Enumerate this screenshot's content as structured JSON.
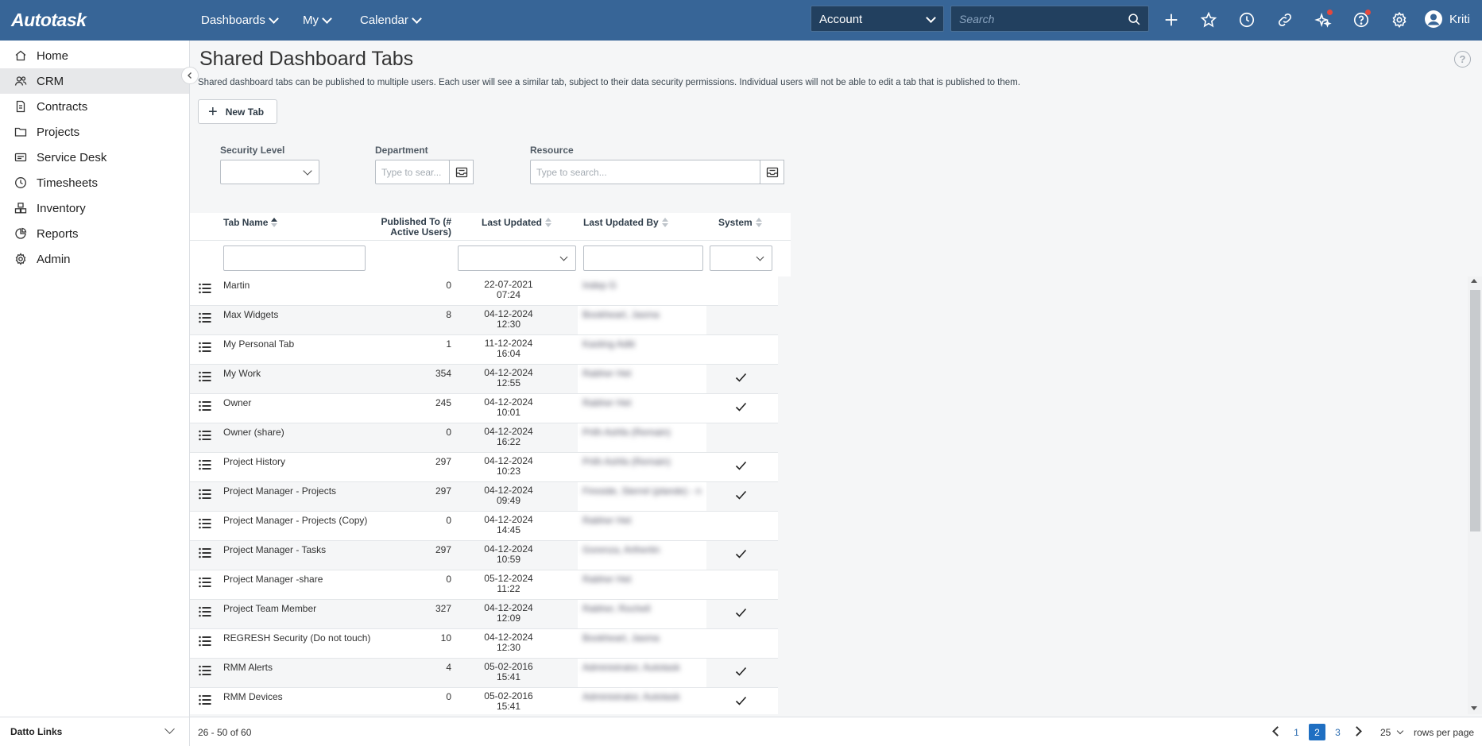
{
  "brand": {
    "logo": "Autotask"
  },
  "topnav": {
    "menus": [
      {
        "label": "Dashboards"
      },
      {
        "label": "My"
      },
      {
        "label": "Calendar"
      }
    ],
    "account_selector": "Account",
    "search_placeholder": "Search",
    "user": "Kriti"
  },
  "sidebar": {
    "items": [
      {
        "label": "Home",
        "icon": "home-icon"
      },
      {
        "label": "CRM",
        "icon": "users-icon"
      },
      {
        "label": "Contracts",
        "icon": "contract-icon"
      },
      {
        "label": "Projects",
        "icon": "folder-icon"
      },
      {
        "label": "Service Desk",
        "icon": "service-desk-icon"
      },
      {
        "label": "Timesheets",
        "icon": "clock-icon"
      },
      {
        "label": "Inventory",
        "icon": "inventory-icon"
      },
      {
        "label": "Reports",
        "icon": "reports-icon"
      },
      {
        "label": "Admin",
        "icon": "gear-icon"
      }
    ],
    "active": "CRM",
    "footer_label": "Datto Links"
  },
  "page": {
    "title": "Shared Dashboard Tabs",
    "description": "Shared dashboard tabs can be published to multiple users. Each user will see a similar tab, subject to their data security permissions. Individual users will not be able to edit a tab that is published to them.",
    "new_tab_label": "New Tab"
  },
  "filters": {
    "security_level_label": "Security Level",
    "department_label": "Department",
    "department_placeholder": "Type to sear...",
    "resource_label": "Resource",
    "resource_placeholder": "Type to search..."
  },
  "table": {
    "columns": {
      "tab_name": "Tab Name",
      "published_to_line1": "Published To (#",
      "published_to_line2": "Active Users)",
      "last_updated": "Last Updated",
      "last_updated_by": "Last Updated By",
      "system": "System"
    },
    "rows": [
      {
        "name": "Martin",
        "published": "0",
        "date": "22-07-2021",
        "time": "07:24",
        "by": "Indep G",
        "system": false
      },
      {
        "name": "Max Widgets",
        "published": "8",
        "date": "04-12-2024",
        "time": "12:30",
        "by": "Bookheart, Jasma",
        "system": false
      },
      {
        "name": "My Personal Tab",
        "published": "1",
        "date": "11-12-2024",
        "time": "16:04",
        "by": "Kasting Aditi",
        "system": false
      },
      {
        "name": "My Work",
        "published": "354",
        "date": "04-12-2024",
        "time": "12:55",
        "by": "Rabher Het",
        "system": true
      },
      {
        "name": "Owner",
        "published": "245",
        "date": "04-12-2024",
        "time": "10:01",
        "by": "Rabher Het",
        "system": true
      },
      {
        "name": "Owner (share)",
        "published": "0",
        "date": "04-12-2024",
        "time": "16:22",
        "by": "Prith Ashfa (Remain)",
        "system": false
      },
      {
        "name": "Project History",
        "published": "297",
        "date": "04-12-2024",
        "time": "10:23",
        "by": "Prith Ashfa (Remain)",
        "system": true
      },
      {
        "name": "Project Manager - Projects",
        "published": "297",
        "date": "04-12-2024",
        "time": "09:49",
        "by": "Fireside, Sterrel (plande) - n",
        "system": true
      },
      {
        "name": "Project Manager - Projects (Copy)",
        "published": "0",
        "date": "04-12-2024",
        "time": "14:45",
        "by": "Rabher Het",
        "system": false
      },
      {
        "name": "Project Manager - Tasks",
        "published": "297",
        "date": "04-12-2024",
        "time": "10:59",
        "by": "Gorenza, Arthertin",
        "system": true
      },
      {
        "name": "Project Manager -share",
        "published": "0",
        "date": "05-12-2024",
        "time": "11:22",
        "by": "Rabher Het",
        "system": false
      },
      {
        "name": "Project Team Member",
        "published": "327",
        "date": "04-12-2024",
        "time": "12:09",
        "by": "Rabher, Rochell",
        "system": true
      },
      {
        "name": "REGRESH Security (Do not touch)",
        "published": "10",
        "date": "04-12-2024",
        "time": "12:30",
        "by": "Bookheart, Jasma",
        "system": false
      },
      {
        "name": "RMM Alerts",
        "published": "4",
        "date": "05-02-2016",
        "time": "15:41",
        "by": "Administrator, Autotask",
        "system": true
      },
      {
        "name": "RMM Devices",
        "published": "0",
        "date": "05-02-2016",
        "time": "15:41",
        "by": "Administrator, Autotask",
        "system": true
      }
    ]
  },
  "pagination": {
    "range": "26 - 50 of 60",
    "pages": [
      "1",
      "2",
      "3"
    ],
    "current": "2",
    "rows_per_page": "25",
    "rows_per_page_label": "rows per page"
  },
  "colors": {
    "topbar": "#376597",
    "accent": "#1f6fc2",
    "notification": "#e5483d"
  }
}
